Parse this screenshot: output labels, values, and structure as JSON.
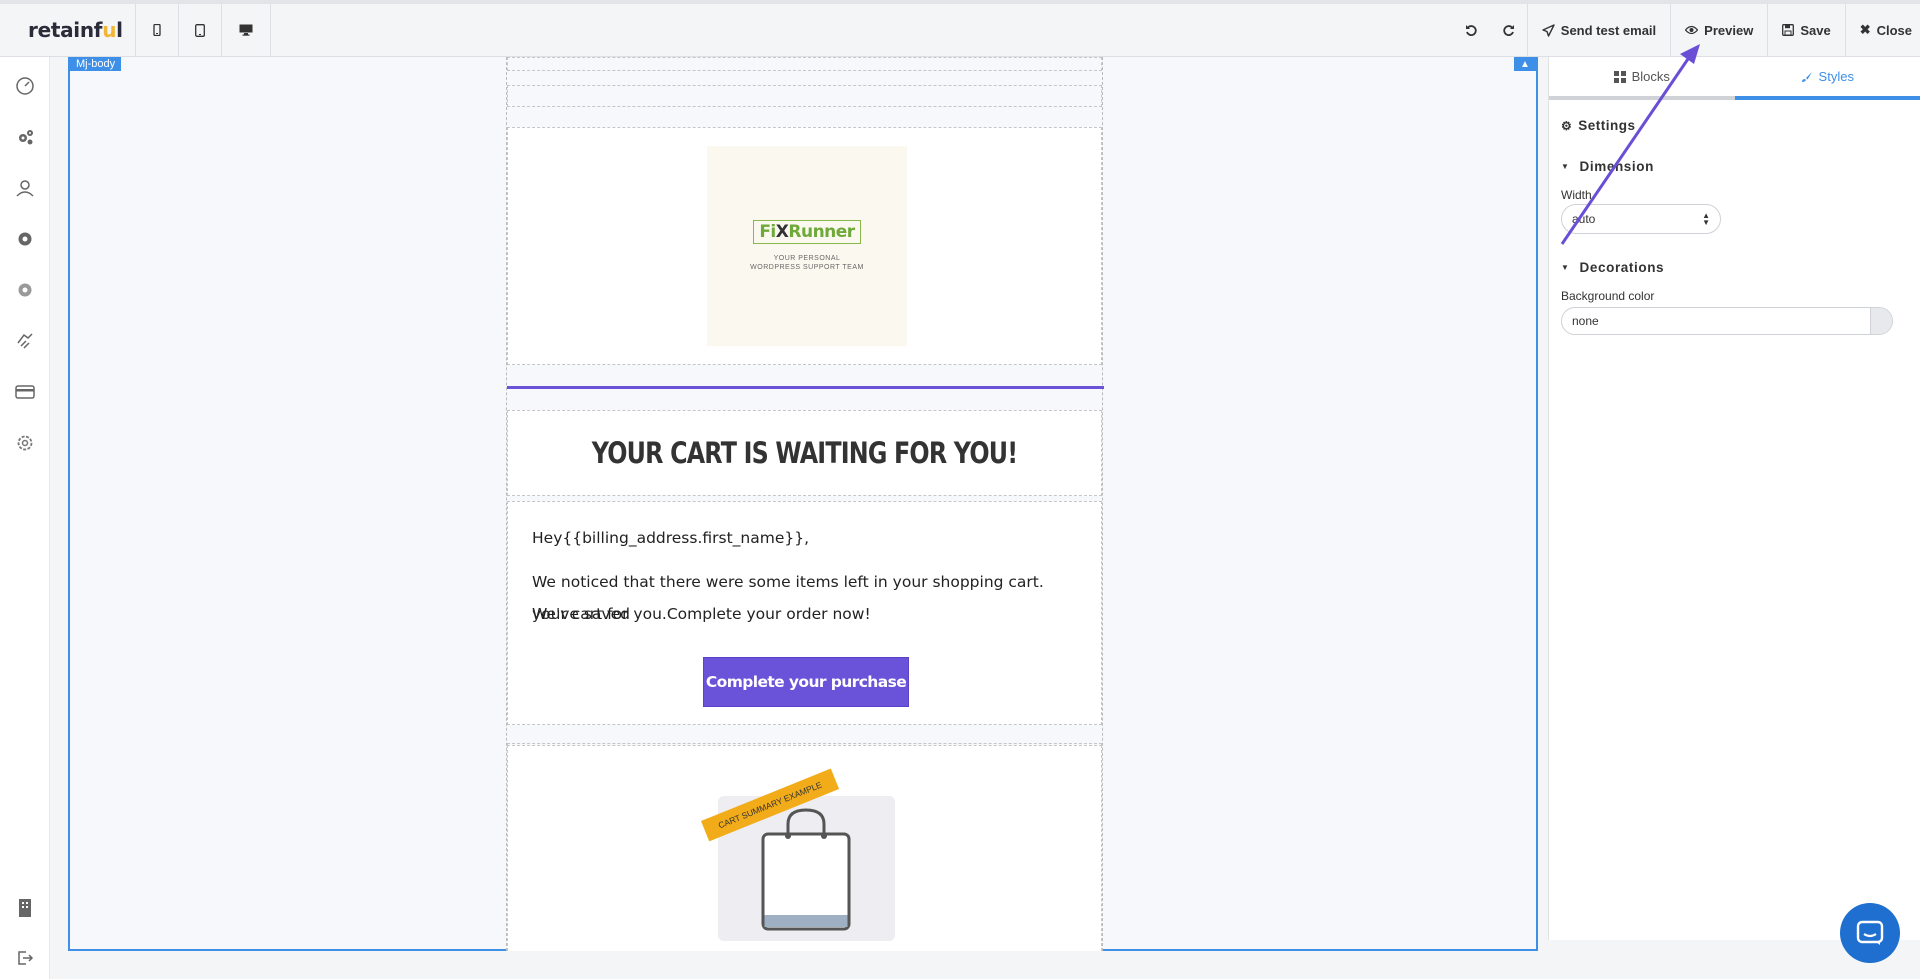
{
  "app": {
    "logo_text": "retainf",
    "logo_u": "u",
    "logo_l": "l"
  },
  "devices": [
    "mobile-icon",
    "tablet-icon",
    "desktop-icon"
  ],
  "toolbar": {
    "undo_icon": "undo-icon",
    "redo_icon": "redo-icon",
    "send_test_label": "Send test email",
    "preview_label": "Preview",
    "save_label": "Save",
    "close_label": "Close"
  },
  "canvas": {
    "body_tag": "Mj-body"
  },
  "email": {
    "headline": "YOUR CART IS WAITING FOR YOU!",
    "greeting": "Hey{{billing_address.first_name}},",
    "body_line1": "We noticed that there were some items left in your shopping cart. We've saved",
    "body_line2": "your cart for you.Complete your order now!",
    "cta_label": "Complete your purchase",
    "ribbon_text": "CART SUMMARY EXAMPLE",
    "brand_logo": {
      "fi": "Fi",
      "x": "X",
      "runner": "Runner",
      "tagline1": "YOUR PERSONAL",
      "tagline2": "WORDPRESS SUPPORT TEAM"
    }
  },
  "panel": {
    "tab_blocks": "Blocks",
    "tab_styles": "Styles",
    "settings_title": "Settings",
    "dimension_title": "Dimension",
    "width_label": "Width",
    "width_value": "auto",
    "decorations_title": "Decorations",
    "bg_color_label": "Background color",
    "bg_color_value": "none"
  },
  "colors": {
    "accent_blue": "#3d8fe8",
    "brand_purple": "#6a52d9",
    "annotation_arrow": "#6a4fd6",
    "ribbon": "#f2ac1a"
  }
}
